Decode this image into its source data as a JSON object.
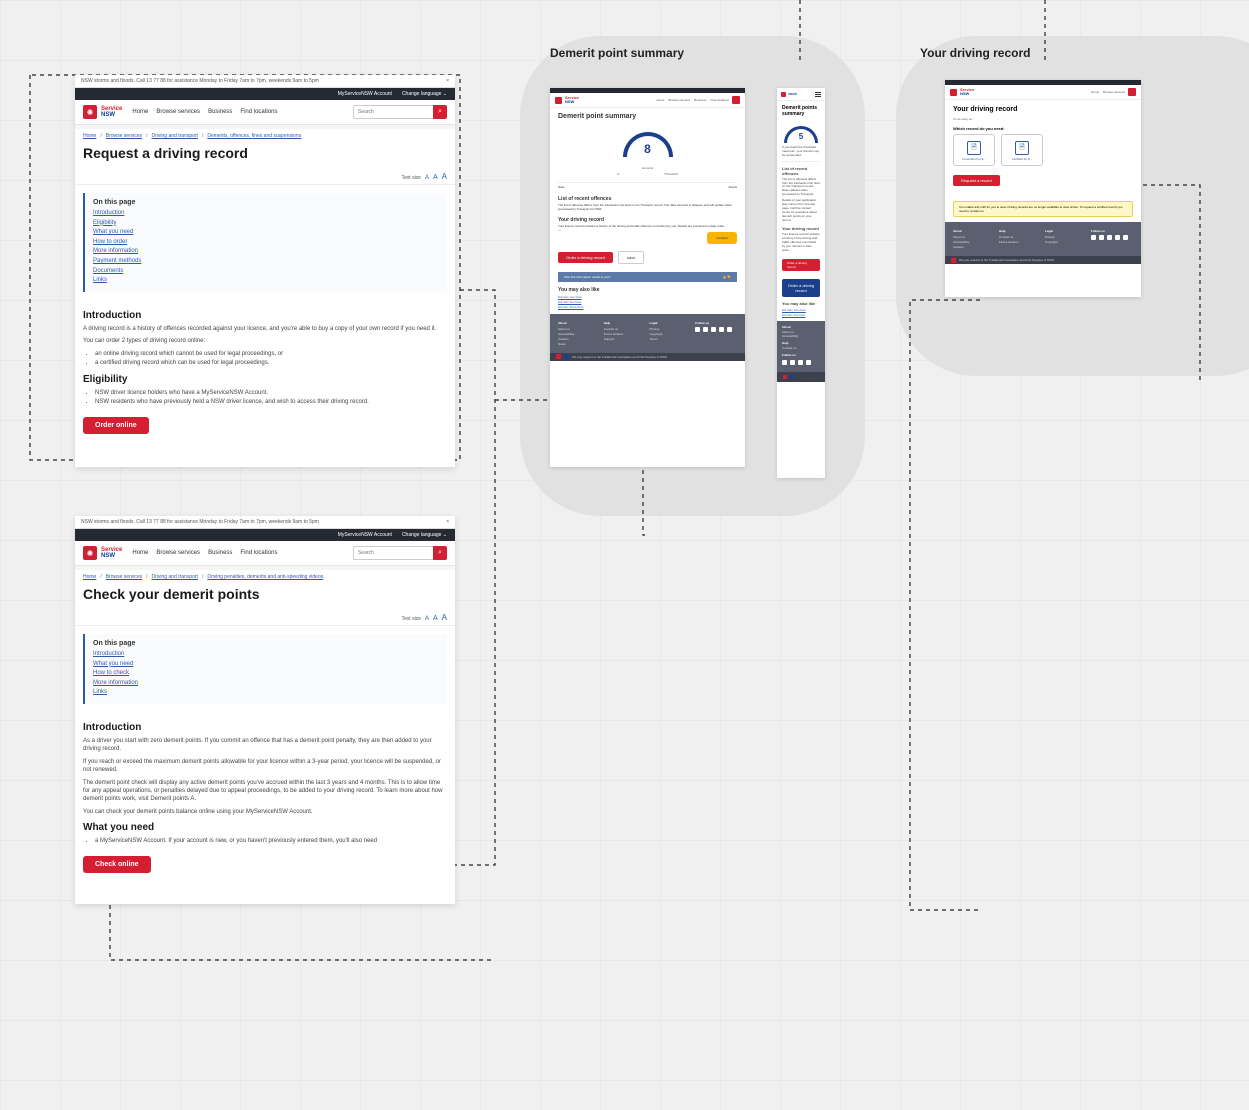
{
  "labels": {
    "demerit": "Demerit point summary",
    "record": "Your driving record"
  },
  "common": {
    "alert": "NSW storms and floods. Call 13 77 88 for assistance Monday to Friday 7am to 7pm, weekends 9am to 5pm",
    "alert2": "NSW storms and floods. Call 13 77 88 for assistance Monday to Friday 7am to 7pm, weekends 9am to 5pm",
    "close": "×",
    "topnav": {
      "account": "MyServiceNSW Account",
      "lang": "Change language ⌄"
    },
    "brand": {
      "top": "Service",
      "bot": "NSW"
    },
    "nav": {
      "home": "Home",
      "browse": "Browse services",
      "business": "Business",
      "locations": "Find locations"
    },
    "search_placeholder": "Search",
    "search_icon": "⌕",
    "textsize_label": "Text size",
    "onpage_title": "On this page",
    "sep": "/"
  },
  "page1": {
    "crumbs": [
      "Home",
      "Browse services",
      "Driving and transport",
      "Demerits, offences, fines and suspensions"
    ],
    "title": "Request a driving record",
    "onpage": [
      "Introduction",
      "Eligibility",
      "What you need",
      "How to order",
      "More information",
      "Payment methods",
      "Documents",
      "Links"
    ],
    "intro_h": "Introduction",
    "intro_p1": "A driving record is a history of offences recorded against your licence, and you're able to buy a copy of your own record if you need it.",
    "intro_p2": "You can order 2 types of driving record online:",
    "intro_li1": "an online driving record which cannot be used for legal proceedings, or",
    "intro_li2": "a certified driving record which can be used for legal proceedings.",
    "elig_h": "Eligibility",
    "elig_li1": "NSW driver licence holders who have a MyServiceNSW Account.",
    "elig_li2": "NSW residents who have previously held a NSW driver licence, and wish to access their driving record.",
    "cta": "Order online"
  },
  "page2": {
    "crumbs": [
      "Home",
      "Browse services",
      "Driving and transport",
      "Driving penalties, demerits and anti-speeding videos"
    ],
    "title": "Check your demerit points",
    "onpage": [
      "Introduction",
      "What you need",
      "How to check",
      "More information",
      "Links"
    ],
    "intro_h": "Introduction",
    "intro_p1": "As a driver you start with zero demerit points. If you commit an offence that has a demerit point penalty, they are then added to your driving record.",
    "intro_p2": "If you reach or exceed the maximum demerit points allowable for your licence within a 3-year period, your licence will be suspended, or not renewed.",
    "intro_p3": "The demerit point check will display any active demerit points you've accrued within the last 3 years and 4 months. This is to allow time for any appeal operations, or penalties delayed due to appeal proceedings, to be added to your driving record. To learn more about how demerit points work, visit Demerit points A.",
    "intro_p4": "You can check your demerit points balance online using your MyServiceNSW Account.",
    "need_h": "What you need",
    "need_li1": "a MyServiceNSW Account. If your account is new, or you haven't previously entered them, you'll also need",
    "cta": "Check online"
  },
  "demerit_desktop": {
    "title": "Demerit point summary",
    "gauge_value": "8",
    "gauge_unit": "demerits",
    "range_lo": "0",
    "range_hi_label": "Threshold",
    "date_label": "Date",
    "status_label": "Status",
    "date_row": {
      "l": "Date",
      "r": "Status"
    },
    "offences_h": "List of recent offences",
    "offences_p": "The list of offences differs from the transaction list held on the Transport record. The data returned is delayed, and will update when processed by Transport for NSW.",
    "record_h": "Your driving record",
    "record_p": "Your licence record contains a history of the driving and traffic offences committed by you. Details are presented in date order.",
    "yellow": "Certified",
    "cta": "Order a driving record",
    "save_outline": "save",
    "blue_band_l": "Was this information useful to you?",
    "blue_band_r": "👍 👎",
    "also_h": "You may also like",
    "also_links": [
      "link item one here",
      "link item two here",
      "link item three here"
    ]
  },
  "demerit_mobile": {
    "title": "Demerit points summary",
    "gauge_value": "5",
    "p1": "If you reach the threshold maximum, your licence may be suspended.",
    "offences_h": "List of recent offences",
    "p2": "The list of offences differs from the transaction list held on the Transport record. Data updates when processed by Transport.",
    "p3": "Details of your application stay current from the last page. Call the contact centre for questions about demerit points on your record.",
    "record_h": "Your driving record",
    "p4": "Your licence record contains a history of the driving and traffic offences committed by you. Shown in date order.",
    "blue_btn": "Order a driving record",
    "also_h": "You may also like"
  },
  "driving_record": {
    "title": "Your driving record",
    "sub1": "It's as easy as...",
    "sub2": "Which record do you need:",
    "card1": "Uncertified for $...",
    "card2": "Certified for $...",
    "cta": "Request a record",
    "note": "It is unable and unfit for you to view. Driving records are no longer available to view online. To request a certified record you need to contact us."
  },
  "footer": {
    "col1_h": "About",
    "col1": [
      "About us",
      "Accessibility",
      "Careers",
      "News"
    ],
    "col2_h": "Help",
    "col2": [
      "Contact us",
      "Find a location",
      "Support"
    ],
    "col3_h": "Legal",
    "col3": [
      "Privacy",
      "Copyright",
      "Terms"
    ],
    "col4_h": "Follow us",
    "bar": "We pay respect to the Traditional Custodians and First Peoples of NSW."
  }
}
